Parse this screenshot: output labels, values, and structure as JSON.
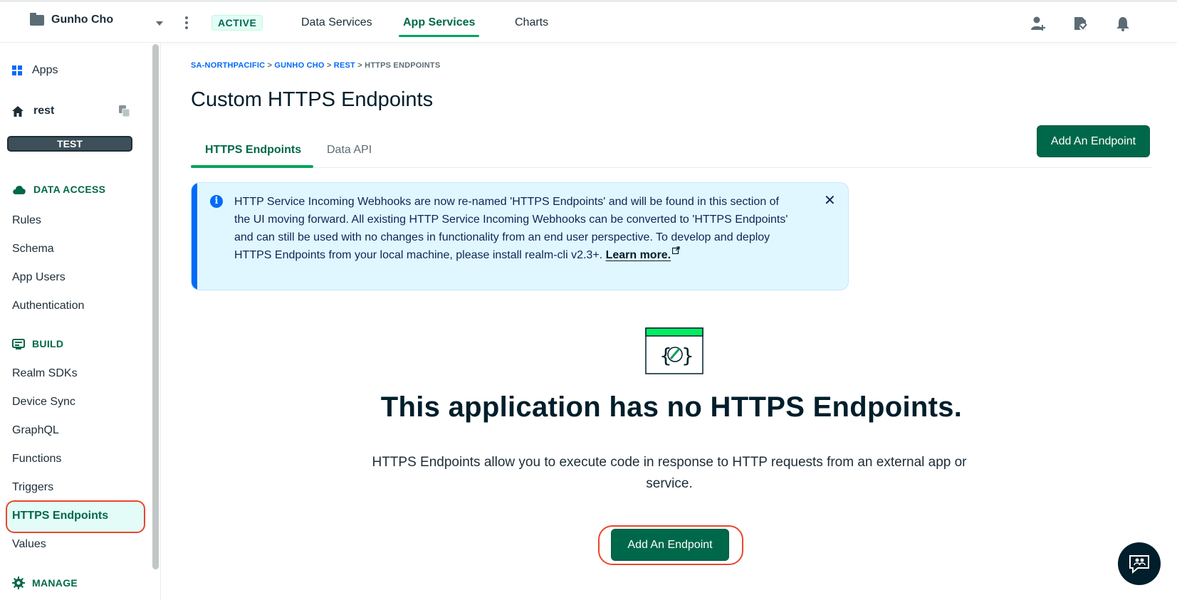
{
  "topbar": {
    "org_name": "Gunho Cho",
    "status_badge": "ACTIVE",
    "nav": [
      {
        "label": "Data Services"
      },
      {
        "label": "App Services"
      },
      {
        "label": "Charts"
      }
    ]
  },
  "sidebar": {
    "apps_label": "Apps",
    "app_name": "rest",
    "env_badge": "TEST",
    "sections": {
      "data_access": "DATA ACCESS",
      "build": "BUILD",
      "manage": "MANAGE"
    },
    "data_access_items": [
      "Rules",
      "Schema",
      "App Users",
      "Authentication"
    ],
    "build_items": [
      "Realm SDKs",
      "Device Sync",
      "GraphQL",
      "Functions",
      "Triggers",
      "HTTPS Endpoints",
      "Values"
    ],
    "selected_item": "HTTPS Endpoints"
  },
  "main": {
    "breadcrumb": {
      "items": [
        "SA-NORTHPACIFIC",
        "GUNHO CHO",
        "REST"
      ],
      "current": "HTTPS ENDPOINTS",
      "separator": ">"
    },
    "title": "Custom HTTPS Endpoints",
    "add_button": "Add An Endpoint",
    "tabs": [
      {
        "label": "HTTPS Endpoints"
      },
      {
        "label": "Data API"
      }
    ],
    "banner": {
      "text": "HTTP Service Incoming Webhooks are now re-named 'HTTPS Endpoints' and will be found in this section of the UI moving forward. All existing HTTP Service Incoming Webhooks can be converted to 'HTTPS Endpoints' and can still be used with no changes in functionality from an end user perspective. To develop and deploy HTTPS Endpoints from your local machine, please install realm-cli v2.3+.",
      "link": "Learn more."
    },
    "empty_state": {
      "title": "This application has no HTTPS Endpoints.",
      "description": "HTTPS Endpoints allow you to execute code in response to HTTP requests from an external app or service.",
      "button": "Add An Endpoint"
    }
  },
  "colors": {
    "brand_green": "#00684a",
    "accent_green": "#00a35c",
    "info_blue": "#016bf8",
    "banner_bg": "#e1f7ff",
    "annotation_red": "#e8472d"
  }
}
